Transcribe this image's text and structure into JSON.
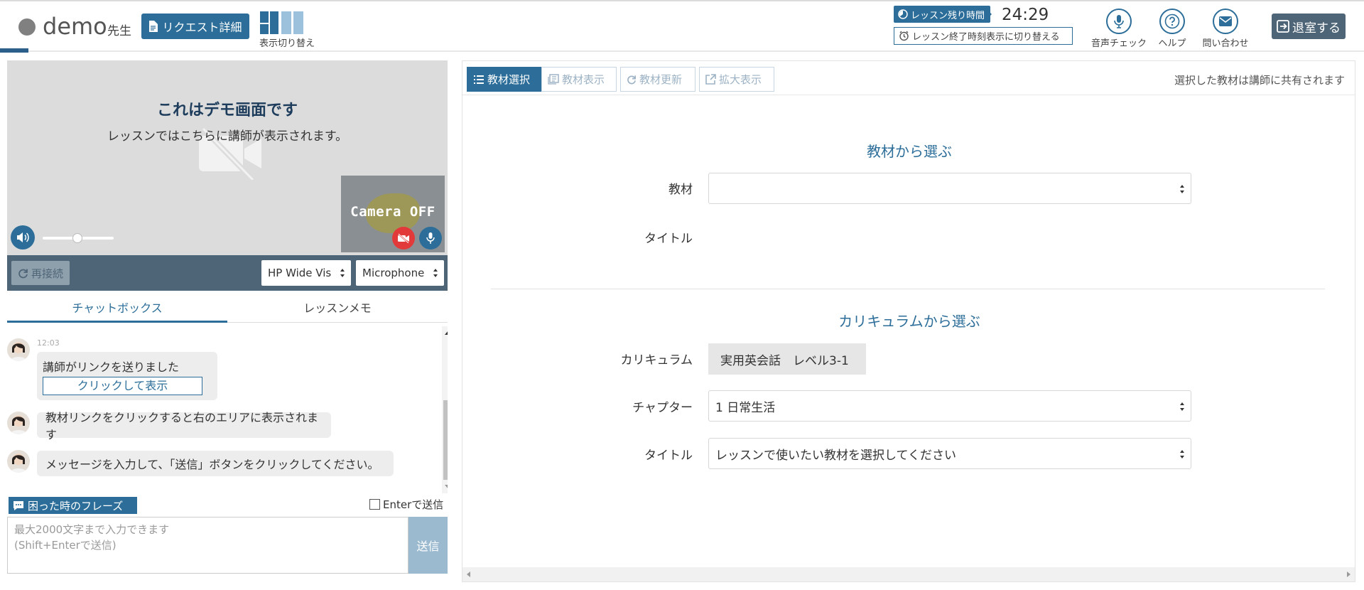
{
  "header": {
    "teacher_name": "demo",
    "teacher_suffix": "先生",
    "request_button": "リクエスト詳細",
    "layout_toggle_label": "表示切り替え",
    "timer_label": "レッスン残り時間",
    "timer_value": "24:29",
    "timer_switch": "レッスン終了時刻表示に切り替える",
    "sound_check": "音声チェック",
    "help": "ヘルプ",
    "contact": "問い合わせ",
    "exit": "退室する",
    "accent_color": "#2c6e99"
  },
  "video": {
    "demo_title": "これはデモ画面です",
    "demo_subtitle": "レッスンではこちらに講師が表示されます。",
    "self_view_text": "Camera OFF",
    "volume_level": 0.5
  },
  "devices": {
    "reconnect": "再接続",
    "camera_select": "HP Wide Vis",
    "mic_select": "Microphone"
  },
  "tabs": {
    "chat": "チャットボックス",
    "memo": "レッスンメモ"
  },
  "chat": {
    "messages": [
      {
        "time": "12:03",
        "text": "講師がリンクを送りました",
        "link": "クリックして表示"
      },
      {
        "text": "教材リンクをクリックすると右のエリアに表示されます"
      },
      {
        "text": "メッセージを入力して、「送信」ボタンをクリックしてください。"
      }
    ],
    "phrase_button": "困った時のフレーズ",
    "enter_send": "Enterで送信",
    "placeholder": "最大2000文字まで入力できます\n(Shift+Enterで送信)",
    "send": "送信"
  },
  "material": {
    "toolbar": {
      "select": "教材選択",
      "show": "教材表示",
      "update": "教材更新",
      "expand": "拡大表示"
    },
    "share_note": "選択した教材は講師に共有されます",
    "from_material": {
      "heading": "教材から選ぶ",
      "material_label": "教材",
      "material_value": "",
      "title_label": "タイトル"
    },
    "from_curriculum": {
      "heading": "カリキュラムから選ぶ",
      "curriculum_label": "カリキュラム",
      "curriculum_value": "実用英会話　レベル3-1",
      "chapter_label": "チャプター",
      "chapter_value": "1 日常生活",
      "title_label": "タイトル",
      "title_value": "レッスンで使いたい教材を選択してください"
    }
  }
}
